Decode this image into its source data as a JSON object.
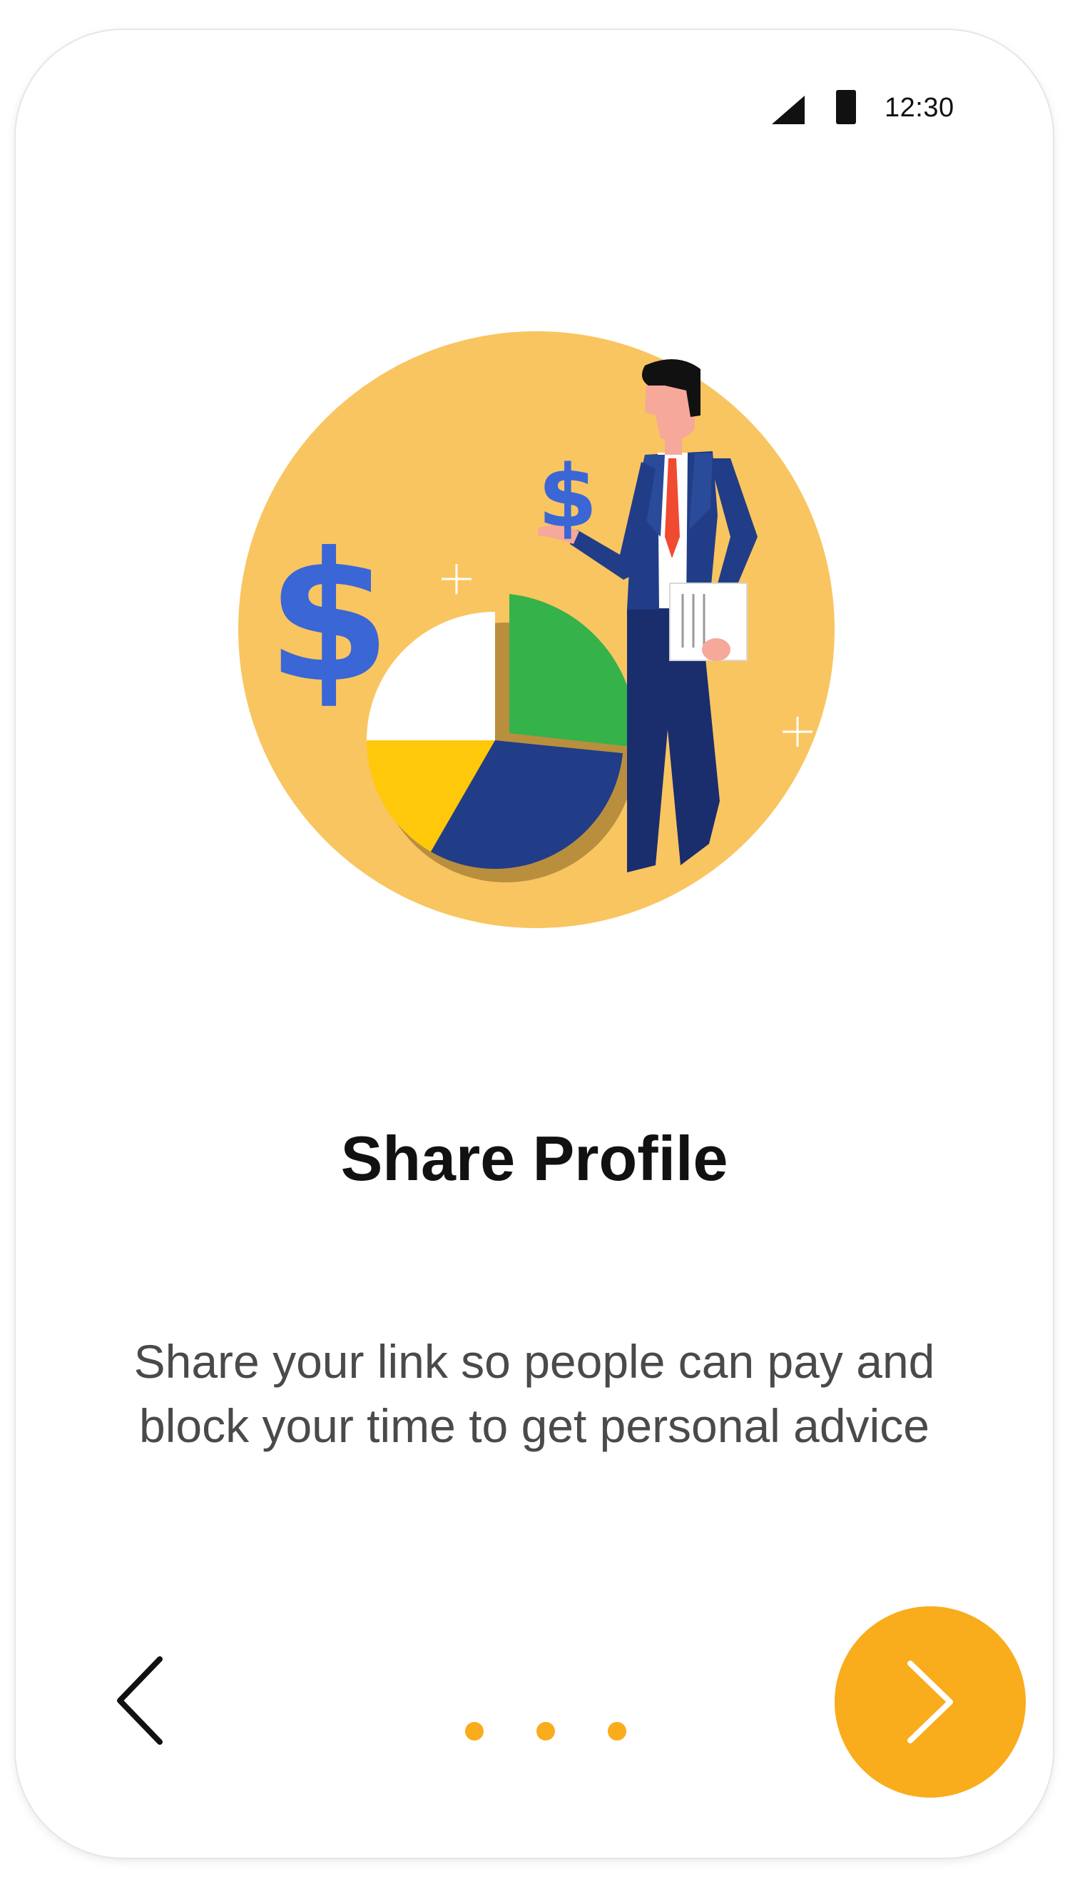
{
  "status_bar": {
    "time": "12:30",
    "icons": [
      "cellular-signal-icon",
      "battery-icon"
    ]
  },
  "onboarding": {
    "illustration": "finance-businessman-illustration",
    "title": "Share Profile",
    "description": "Share your link so people can pay and block your time to get personal advice"
  },
  "navigation": {
    "back_icon": "chevron-left-icon",
    "next_icon": "chevron-right-icon",
    "page_indicator_count": 3
  },
  "colors": {
    "accent": "#F9AC1C",
    "illustration_circle": "#F9C560",
    "dollar_blue": "#3A66D6",
    "suit_navy": "#213D87",
    "pie_green": "#35B24A",
    "pie_yellow": "#FFC80A",
    "tie_red": "#F04A30",
    "text_dark": "#111111",
    "text_body": "#4A4A4A"
  }
}
